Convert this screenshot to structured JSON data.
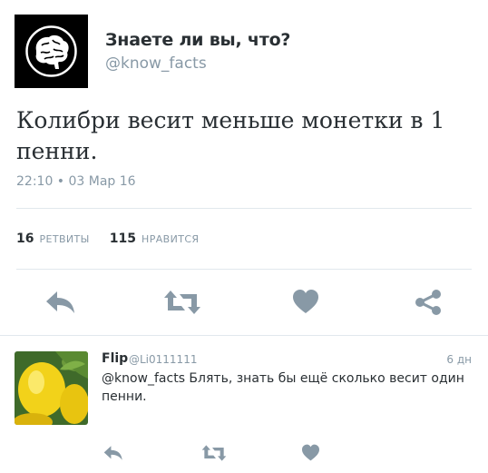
{
  "tweet": {
    "display_name": "Знаете ли вы, что?",
    "handle": "@know_facts",
    "text": "Колибри весит меньше монетки в 1 пенни.",
    "timestamp": "22:10 • 03 Мар 16"
  },
  "stats": {
    "retweets_count": "16",
    "retweets_label": "РЕТВИТЫ",
    "likes_count": "115",
    "likes_label": "НРАВИТСЯ"
  },
  "icons": {
    "reply": "reply-icon",
    "retweet": "retweet-icon",
    "like": "heart-icon",
    "share": "share-icon"
  },
  "reply": {
    "display_name": "Flip",
    "handle": "@Li0111111",
    "time": "6 дн",
    "text": "@know_facts Блять, знать бы ещё сколько весит один пенни."
  },
  "colors": {
    "icon_gray": "#8899a6",
    "text": "#292f33",
    "divider": "#e1e8ed"
  }
}
